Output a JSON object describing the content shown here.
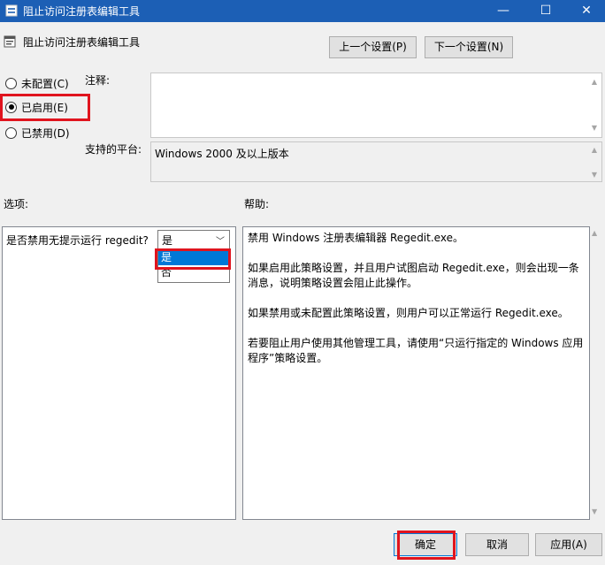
{
  "window": {
    "title": "阻止访问注册表编辑工具",
    "controls": {
      "minimize": "—",
      "maximize": "☐",
      "close": "✕"
    }
  },
  "header": {
    "policy_name": "阻止访问注册表编辑工具",
    "prev_label": "上一个设置(P)",
    "next_label": "下一个设置(N)"
  },
  "state": {
    "options": [
      {
        "label": "未配置(C)",
        "checked": false
      },
      {
        "label": "已启用(E)",
        "checked": true
      },
      {
        "label": "已禁用(D)",
        "checked": false
      }
    ]
  },
  "comment": {
    "label": "注释:",
    "value": ""
  },
  "platform": {
    "label": "支持的平台:",
    "value": "Windows 2000 及以上版本"
  },
  "options": {
    "label": "选项:",
    "question": "是否禁用无提示运行 regedit?",
    "combo_value": "是",
    "dropdown_items": [
      "是",
      "否"
    ]
  },
  "help": {
    "label": "帮助:",
    "paragraphs": [
      "禁用 Windows 注册表编辑器 Regedit.exe。",
      "如果启用此策略设置，并且用户试图启动 Regedit.exe，则会出现一条消息，说明策略设置会阻止此操作。",
      "如果禁用或未配置此策略设置，则用户可以正常运行 Regedit.exe。",
      "若要阻止用户使用其他管理工具，请使用“只运行指定的 Windows 应用程序”策略设置。"
    ]
  },
  "footer": {
    "ok_label": "确定",
    "cancel_label": "取消",
    "apply_label": "应用(A)"
  },
  "colors": {
    "titlebar": "#1c5fb5",
    "highlight_red": "#e0141e",
    "selection_blue": "#0078d7"
  }
}
